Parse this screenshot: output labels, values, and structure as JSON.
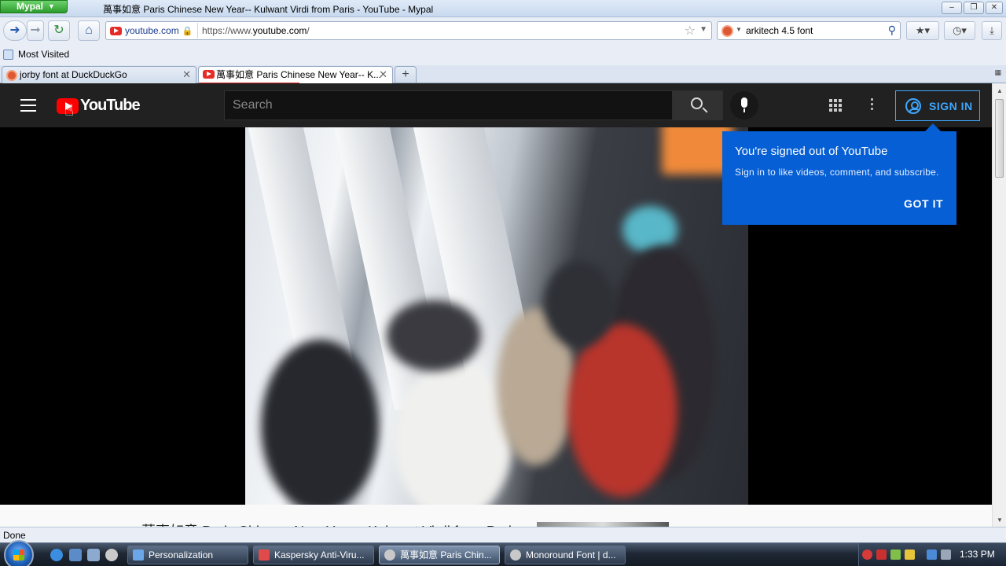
{
  "window": {
    "app_menu": "Mypal",
    "title": "萬事如意 Paris Chinese New Year-- Kulwant Virdi from Paris - YouTube - Mypal"
  },
  "nav": {
    "site_identity": "youtube.com",
    "url_prefix": "https://www.",
    "url_domain": "youtube.com",
    "url_suffix": "/",
    "search_value": "arkitech 4.5 font"
  },
  "bookmarks": {
    "most_visited": "Most Visited"
  },
  "tabs": [
    {
      "label": "jorby font at DuckDuckGo",
      "active": false
    },
    {
      "label": "萬事如意 Paris Chinese New Year-- K...",
      "active": true
    }
  ],
  "youtube": {
    "logo_text": "YouTube",
    "search_placeholder": "Search",
    "signin_label": "SIGN IN",
    "popup": {
      "title": "You're signed out of YouTube",
      "subtitle": "Sign in to like videos, comment, and subscribe.",
      "button": "GOT IT"
    },
    "below_title": "萬事如意 Paris Chinese New Year-- Kulwant Virdi from Paris"
  },
  "status": {
    "text": "Done"
  },
  "taskbar": {
    "tasks": [
      {
        "label": "Personalization",
        "active": false
      },
      {
        "label": "Kaspersky Anti-Viru...",
        "active": false
      },
      {
        "label": "萬事如意 Paris Chin...",
        "active": true
      },
      {
        "label": "Monoround Font | d...",
        "active": false
      }
    ],
    "clock": "1:33 PM"
  },
  "colors": {
    "youtube_red": "#ff0000",
    "signin_blue": "#3ea6ff",
    "popup_blue": "#065fd4",
    "masthead": "#212121"
  }
}
